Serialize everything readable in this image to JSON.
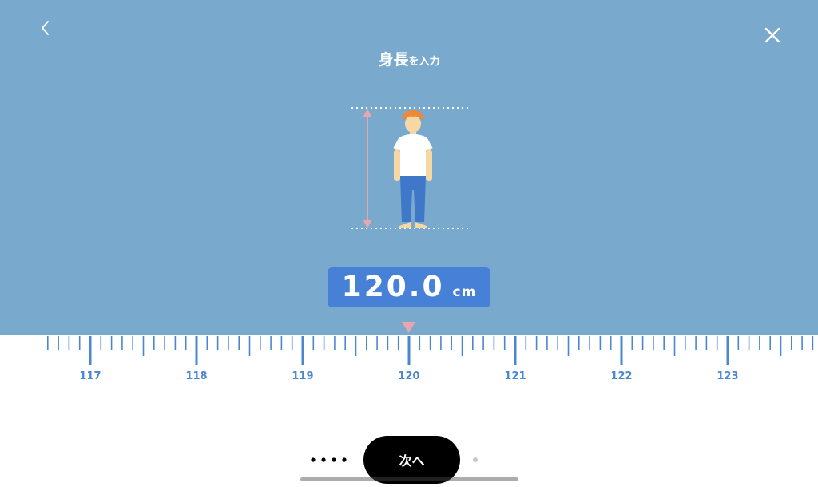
{
  "header": {
    "title_main": "身長",
    "title_suffix": "を入力",
    "back_icon": "chevron-left-icon",
    "close_icon": "close-icon"
  },
  "measurement": {
    "value": "120.0",
    "unit": "cm"
  },
  "ruler": {
    "min": 116.6,
    "max": 123.8,
    "step": 0.1,
    "labels": [
      "117",
      "118",
      "119",
      "120",
      "121",
      "122",
      "123"
    ],
    "selected": 120.0
  },
  "footer": {
    "next_label": "次へ"
  },
  "colors": {
    "background": "#79a9cc",
    "accent": "#4781d7",
    "ruler_tick": "#4a87cf",
    "pointer": "#e9a6ad",
    "button": "#000000"
  }
}
